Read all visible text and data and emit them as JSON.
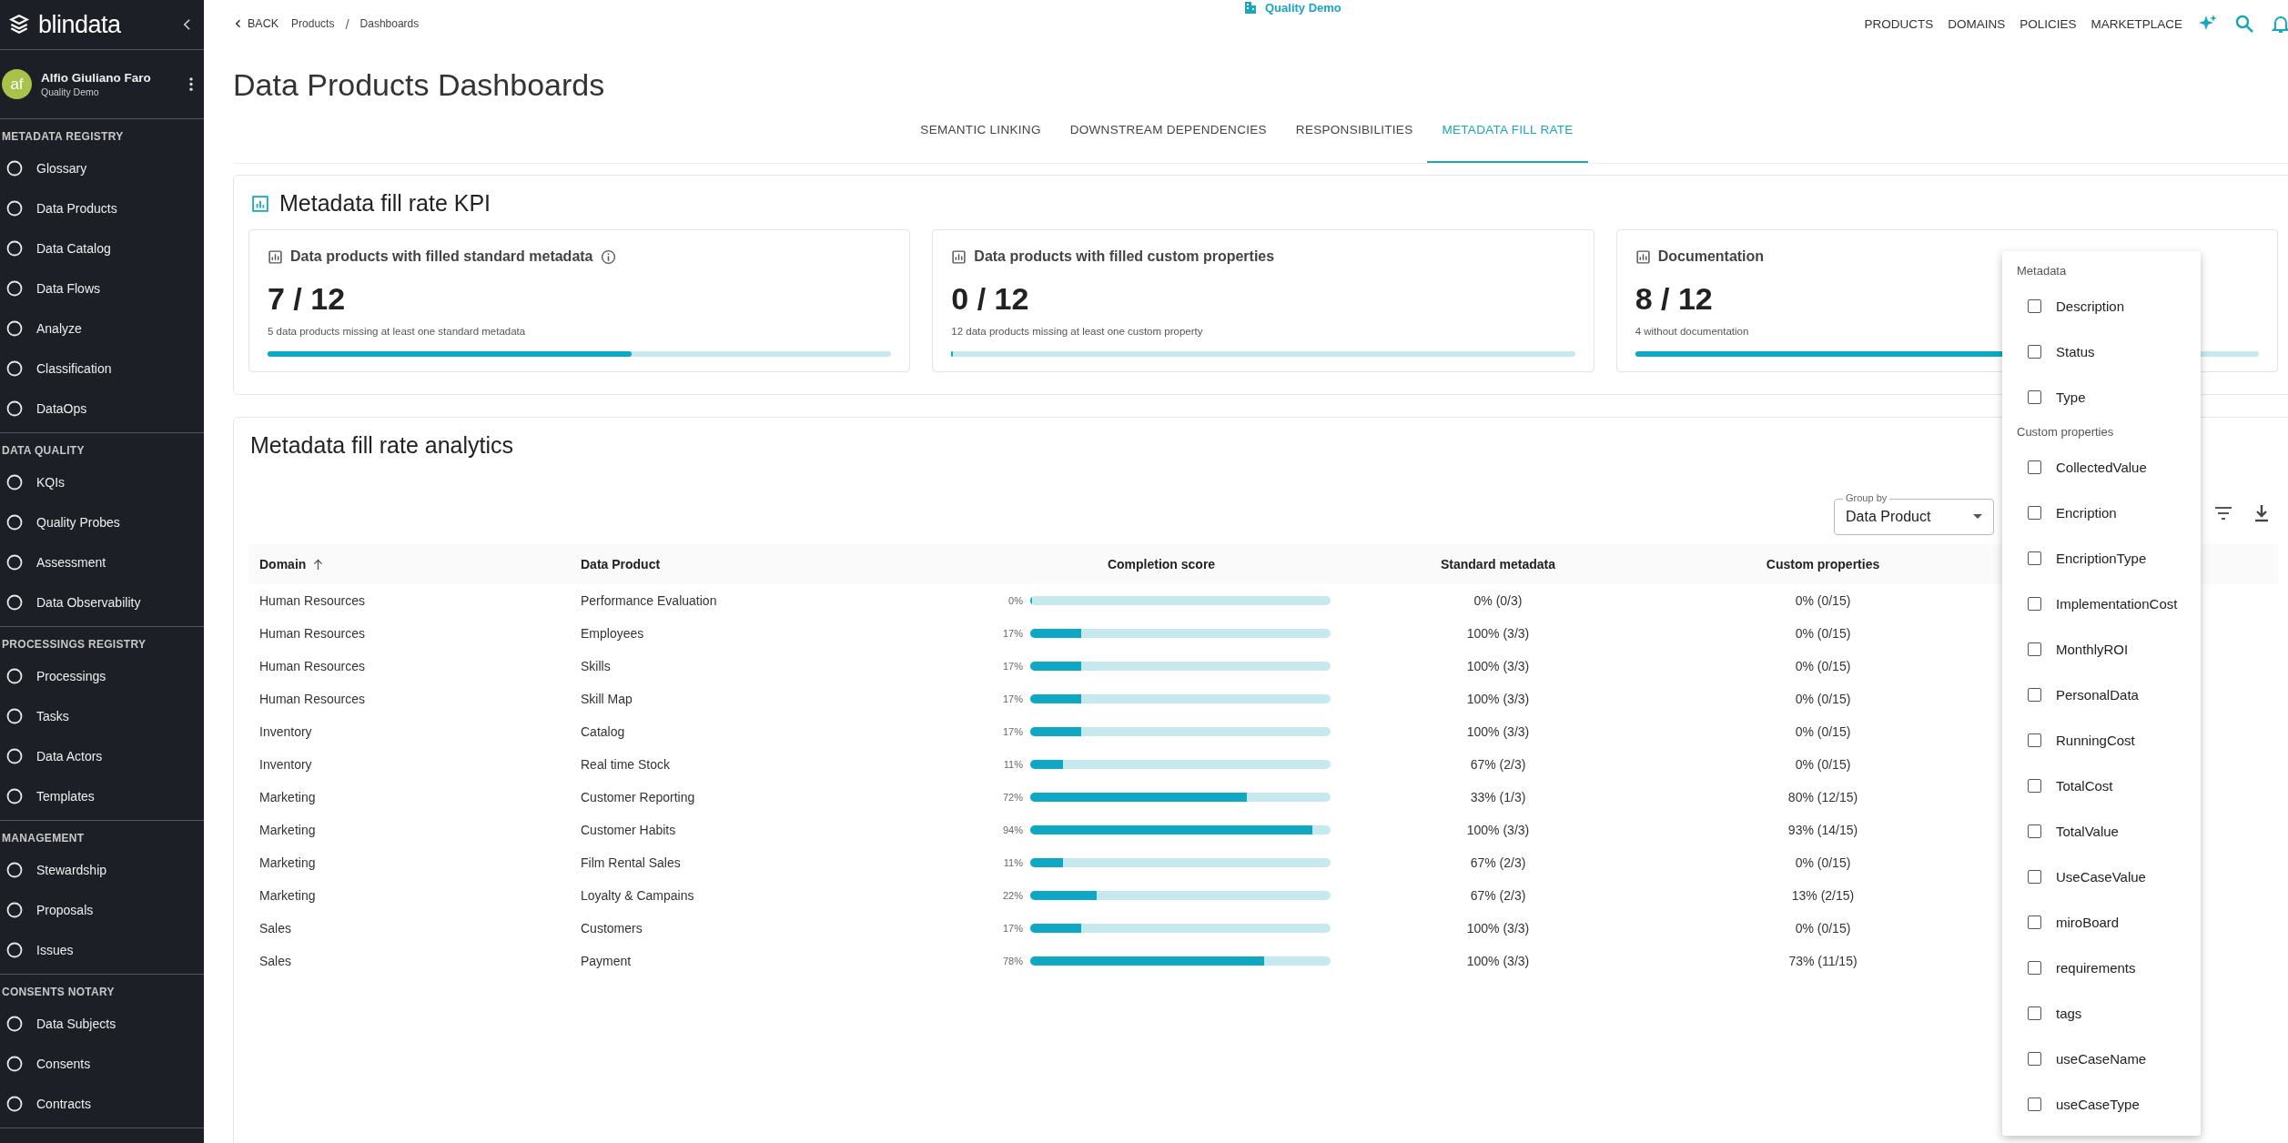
{
  "sidebar": {
    "logo": "blindata",
    "user": {
      "initials": "af",
      "name": "Alfio Giuliano Faro",
      "subtitle": "Quality Demo"
    },
    "sections": [
      {
        "title": "METADATA REGISTRY",
        "items": [
          "Glossary",
          "Data Products",
          "Data Catalog",
          "Data Flows",
          "Analyze",
          "Classification",
          "DataOps"
        ]
      },
      {
        "title": "DATA QUALITY",
        "items": [
          "KQIs",
          "Quality Probes",
          "Assessment",
          "Data Observability"
        ]
      },
      {
        "title": "PROCESSINGS REGISTRY",
        "items": [
          "Processings",
          "Tasks",
          "Data Actors",
          "Templates"
        ]
      },
      {
        "title": "MANAGEMENT",
        "items": [
          "Stewardship",
          "Proposals",
          "Issues"
        ]
      },
      {
        "title": "CONSENTS NOTARY",
        "items": [
          "Data Subjects",
          "Consents",
          "Contracts"
        ]
      }
    ]
  },
  "topbar": {
    "back": "BACK",
    "breadcrumb": [
      "Products",
      "Dashboards"
    ],
    "breadcrumb_separator": "/",
    "tenant": "Quality Demo",
    "nav": [
      "PRODUCTS",
      "DOMAINS",
      "POLICIES",
      "MARKETPLACE"
    ]
  },
  "page_title": "Data Products Dashboards",
  "tabs": [
    {
      "label": "SEMANTIC LINKING",
      "selected": false
    },
    {
      "label": "DOWNSTREAM DEPENDENCIES",
      "selected": false
    },
    {
      "label": "RESPONSIBILITIES",
      "selected": false
    },
    {
      "label": "METADATA FILL RATE",
      "selected": true
    }
  ],
  "kpi": {
    "title": "Metadata fill rate KPI",
    "cards": [
      {
        "title": "Data products with filled standard metadata",
        "value": "7 / 12",
        "caption": "5 data products missing at least one standard metadata",
        "level": 0.583,
        "info": true
      },
      {
        "title": "Data products with filled custom properties",
        "value": "0 / 12",
        "caption": "12 data products missing at least one custom property",
        "level": 0,
        "info": false
      },
      {
        "title": "Documentation",
        "value": "8 / 12",
        "caption": "4 without documentation",
        "level": 0.667,
        "info": false
      }
    ]
  },
  "analytics": {
    "title": "Metadata fill rate analytics",
    "group_by": {
      "label": "Group by",
      "value": "Data Product"
    },
    "columns": [
      "Domain",
      "Data Product",
      "Completion score",
      "Standard metadata",
      "Custom properties"
    ],
    "rows": [
      {
        "domain": "Human Resources",
        "product": "Performance Evaluation",
        "score": "0%",
        "level": 0,
        "standard": "0% (0/3)",
        "custom": "0% (0/15)"
      },
      {
        "domain": "Human Resources",
        "product": "Employees",
        "score": "17%",
        "level": 0.17,
        "standard": "100% (3/3)",
        "custom": "0% (0/15)"
      },
      {
        "domain": "Human Resources",
        "product": "Skills",
        "score": "17%",
        "level": 0.17,
        "standard": "100% (3/3)",
        "custom": "0% (0/15)"
      },
      {
        "domain": "Human Resources",
        "product": "Skill Map",
        "score": "17%",
        "level": 0.17,
        "standard": "100% (3/3)",
        "custom": "0% (0/15)"
      },
      {
        "domain": "Inventory",
        "product": "Catalog",
        "score": "17%",
        "level": 0.17,
        "standard": "100% (3/3)",
        "custom": "0% (0/15)"
      },
      {
        "domain": "Inventory",
        "product": "Real time Stock",
        "score": "11%",
        "level": 0.11,
        "standard": "67% (2/3)",
        "custom": "0% (0/15)"
      },
      {
        "domain": "Marketing",
        "product": "Customer Reporting",
        "score": "72%",
        "level": 0.72,
        "standard": "33% (1/3)",
        "custom": "80% (12/15)"
      },
      {
        "domain": "Marketing",
        "product": "Customer Habits",
        "score": "94%",
        "level": 0.94,
        "standard": "100% (3/3)",
        "custom": "93% (14/15)"
      },
      {
        "domain": "Marketing",
        "product": "Film Rental Sales",
        "score": "11%",
        "level": 0.11,
        "standard": "67% (2/3)",
        "custom": "0% (0/15)"
      },
      {
        "domain": "Marketing",
        "product": "Loyalty & Campains",
        "score": "22%",
        "level": 0.22,
        "standard": "67% (2/3)",
        "custom": "13% (2/15)"
      },
      {
        "domain": "Sales",
        "product": "Customers",
        "score": "17%",
        "level": 0.17,
        "standard": "100% (3/3)",
        "custom": "0% (0/15)"
      },
      {
        "domain": "Sales",
        "product": "Payment",
        "score": "78%",
        "level": 0.78,
        "standard": "100% (3/3)",
        "custom": "73% (11/15)"
      }
    ]
  },
  "column_menu": {
    "groups": [
      {
        "title": "Metadata",
        "items": [
          {
            "label": "Description",
            "checked": false
          },
          {
            "label": "Status",
            "checked": false
          },
          {
            "label": "Type",
            "checked": false
          }
        ]
      },
      {
        "title": "Custom properties",
        "items": [
          {
            "label": "CollectedValue",
            "checked": false
          },
          {
            "label": "Encription",
            "checked": false
          },
          {
            "label": "EncriptionType",
            "checked": false
          },
          {
            "label": "ImplementationCost",
            "checked": false
          },
          {
            "label": "MonthlyROI",
            "checked": false
          },
          {
            "label": "PersonalData",
            "checked": false
          },
          {
            "label": "RunningCost",
            "checked": false
          },
          {
            "label": "TotalCost",
            "checked": false
          },
          {
            "label": "TotalValue",
            "checked": false
          },
          {
            "label": "UseCaseValue",
            "checked": false
          },
          {
            "label": "miroBoard",
            "checked": false
          },
          {
            "label": "requirements",
            "checked": false
          },
          {
            "label": "tags",
            "checked": false
          },
          {
            "label": "useCaseName",
            "checked": false
          },
          {
            "label": "useCaseType",
            "checked": false
          }
        ]
      }
    ]
  }
}
